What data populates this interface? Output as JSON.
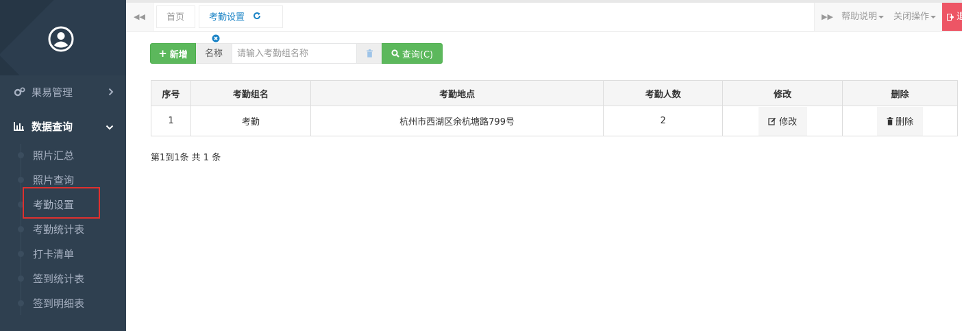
{
  "sidebar": {
    "menu": [
      {
        "label": "果易管理",
        "icon": "cogs-icon",
        "arrow": "chevron-right-icon"
      },
      {
        "label": "数据查询",
        "icon": "bar-chart-icon",
        "arrow": "chevron-down-icon",
        "active": true
      }
    ],
    "sub_items": [
      {
        "label": "照片汇总"
      },
      {
        "label": "照片查询"
      },
      {
        "label": "考勤设置",
        "selected": true
      },
      {
        "label": "考勤统计表"
      },
      {
        "label": "打卡清单"
      },
      {
        "label": "签到统计表"
      },
      {
        "label": "签到明细表"
      }
    ]
  },
  "tabs": {
    "home": "首页",
    "attendance": "考勤设置"
  },
  "topmenu": {
    "help": "帮助说明",
    "close": "关闭操作",
    "logout": "退出"
  },
  "toolbar": {
    "add_label": "新增",
    "name_label": "名称",
    "search_placeholder": "请输入考勤组名称",
    "query_label": "查询(C)"
  },
  "table": {
    "headers": [
      "序号",
      "考勤组名",
      "考勤地点",
      "考勤人数",
      "修改",
      "删除"
    ],
    "rows": [
      {
        "index": "1",
        "group": "考勤",
        "location": "杭州市西湖区余杭塘路799号",
        "count": "2",
        "edit": "修改",
        "delete": "删除"
      }
    ]
  },
  "pagination": {
    "info": "第1到1条 共 1 条"
  },
  "colors": {
    "sidebar_bg": "#2f4050",
    "sidebar_text": "#a7b1c2",
    "primary_green": "#5cb85c",
    "tab_active": "#1c84c6",
    "logout_red": "#ed5565",
    "highlight_red": "#e0302e"
  }
}
